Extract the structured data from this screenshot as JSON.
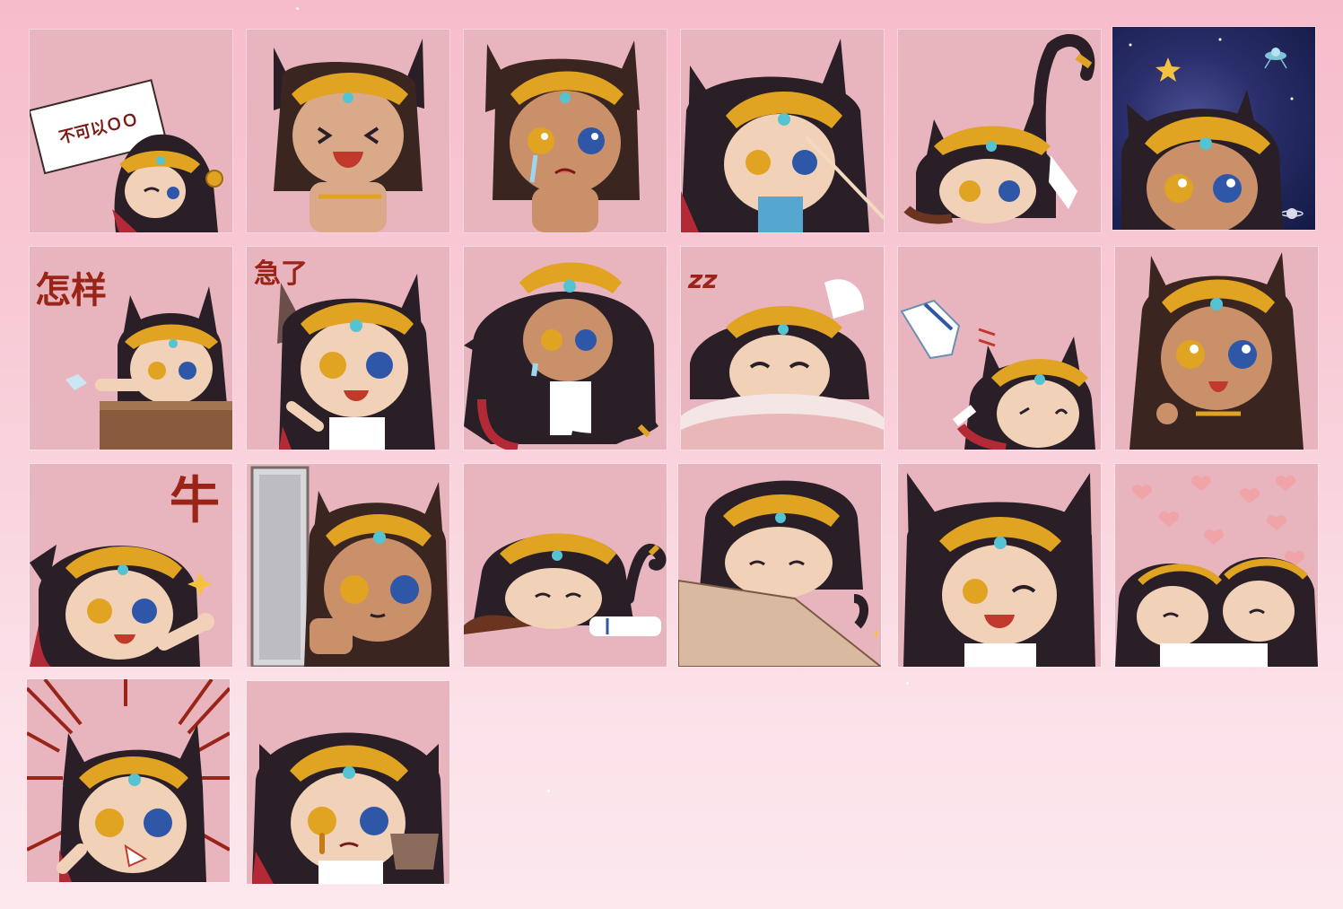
{
  "page": {
    "background_top": "#f7bccb",
    "background_bottom": "#fde8ee",
    "tile_color": "#e8b5bf"
  },
  "stickers": [
    {
      "id": 1,
      "caption": "不可以ＯＯ",
      "icon": "cat-girl-holding-sign-icon"
    },
    {
      "id": 2,
      "caption": "",
      "icon": "cat-girl-laughing-icon"
    },
    {
      "id": 3,
      "caption": "",
      "icon": "cat-girl-crying-icon"
    },
    {
      "id": 4,
      "caption": "",
      "icon": "cat-girl-poked-icon"
    },
    {
      "id": 5,
      "caption": "",
      "icon": "cat-girl-tail-up-icon"
    },
    {
      "id": 6,
      "caption": "",
      "icon": "cat-girl-space-icon"
    },
    {
      "id": 7,
      "caption": "怎样",
      "icon": "cat-girl-desk-icon"
    },
    {
      "id": 8,
      "caption": "急了",
      "icon": "cat-girl-pointing-icon"
    },
    {
      "id": 9,
      "caption": "",
      "icon": "cat-girl-sitting-teary-icon"
    },
    {
      "id": 10,
      "caption": "zz",
      "icon": "cat-girl-sleepy-icon"
    },
    {
      "id": 11,
      "caption": "",
      "icon": "cat-girl-throwing-cloth-icon"
    },
    {
      "id": 12,
      "caption": "",
      "icon": "cat-girl-waving-icon"
    },
    {
      "id": 13,
      "caption": "牛",
      "icon": "cat-girl-thumbs-up-icon"
    },
    {
      "id": 14,
      "caption": "",
      "icon": "cat-girl-peeking-door-icon"
    },
    {
      "id": 15,
      "caption": "",
      "icon": "cat-girl-lying-down-icon"
    },
    {
      "id": 16,
      "caption": "",
      "icon": "cat-girl-on-box-icon"
    },
    {
      "id": 17,
      "caption": "",
      "icon": "cat-girl-happy-icon"
    },
    {
      "id": 18,
      "caption": "",
      "icon": "cat-girl-hug-hearts-icon"
    },
    {
      "id": 19,
      "caption": "",
      "icon": "cat-girl-shocked-icon"
    },
    {
      "id": 20,
      "caption": "",
      "icon": "cat-girl-drooling-icon"
    }
  ]
}
